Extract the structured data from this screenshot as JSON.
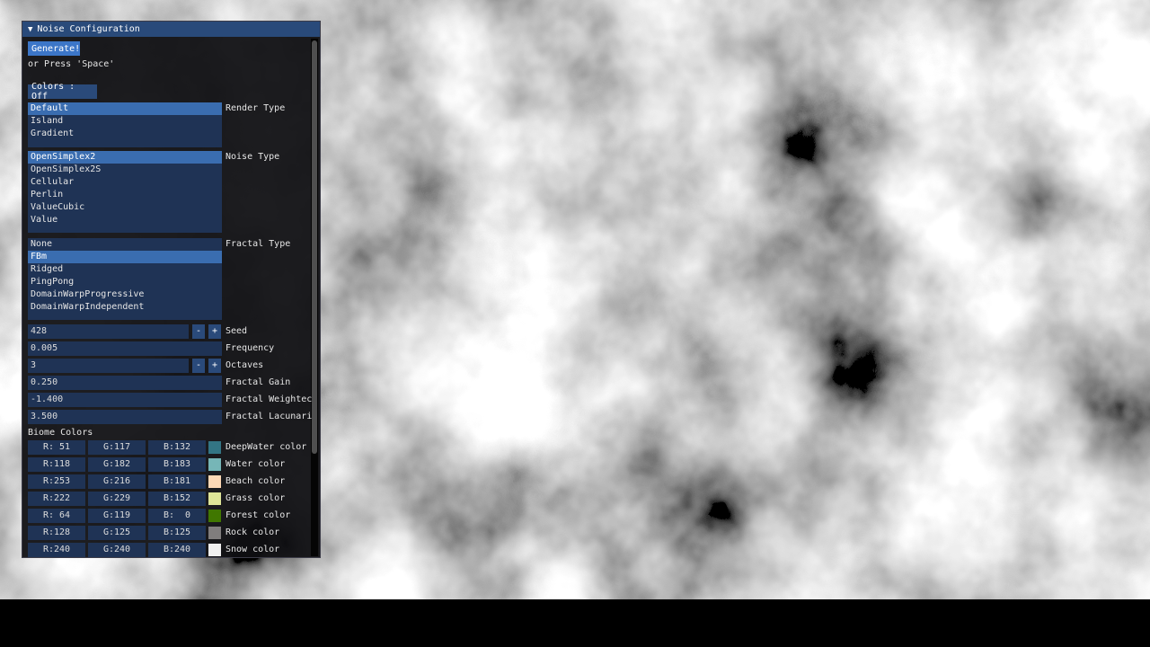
{
  "window": {
    "title": "Noise Configuration",
    "generate_label": "Generate!",
    "hint": "or Press 'Space'",
    "colors_toggle_label": "Colors : Off"
  },
  "render_type": {
    "label": "Render Type",
    "options": [
      "Default",
      "Island",
      "Gradient"
    ],
    "selected": "Default"
  },
  "noise_type": {
    "label": "Noise Type",
    "options": [
      "OpenSimplex2",
      "OpenSimplex2S",
      "Cellular",
      "Perlin",
      "ValueCubic",
      "Value"
    ],
    "selected": "OpenSimplex2"
  },
  "fractal_type": {
    "label": "Fractal Type",
    "options": [
      "None",
      "FBm",
      "Ridged",
      "PingPong",
      "DomainWarpProgressive",
      "DomainWarpIndependent"
    ],
    "selected": "FBm"
  },
  "params": {
    "seed": {
      "value": "428",
      "label": "Seed"
    },
    "frequency": {
      "value": "0.005",
      "label": "Frequency"
    },
    "octaves": {
      "value": "3",
      "label": "Octaves"
    },
    "gain": {
      "value": "0.250",
      "label": "Fractal Gain"
    },
    "weighted": {
      "value": "-1.400",
      "label": "Fractal Weightec"
    },
    "lacunarity": {
      "value": "3.500",
      "label": "Fractal Lacunari"
    },
    "minus": "-",
    "plus": "+"
  },
  "biome": {
    "heading": "Biome Colors",
    "rows": [
      {
        "r": "R: 51",
        "g": "G:117",
        "b": "B:132",
        "label": "DeepWater color",
        "color": "#337584"
      },
      {
        "r": "R:118",
        "g": "G:182",
        "b": "B:183",
        "label": "Water color",
        "color": "#76b6b7"
      },
      {
        "r": "R:253",
        "g": "G:216",
        "b": "B:181",
        "label": "Beach color",
        "color": "#fdd8b5"
      },
      {
        "r": "R:222",
        "g": "G:229",
        "b": "B:152",
        "label": "Grass color",
        "color": "#dee598"
      },
      {
        "r": "R: 64",
        "g": "G:119",
        "b": "B:  0",
        "label": "Forest color",
        "color": "#407700"
      },
      {
        "r": "R:128",
        "g": "G:125",
        "b": "B:125",
        "label": "Rock color",
        "color": "#807d7d"
      },
      {
        "r": "R:240",
        "g": "G:240",
        "b": "B:240",
        "label": "Snow color",
        "color": "#f0f0f0"
      }
    ]
  }
}
